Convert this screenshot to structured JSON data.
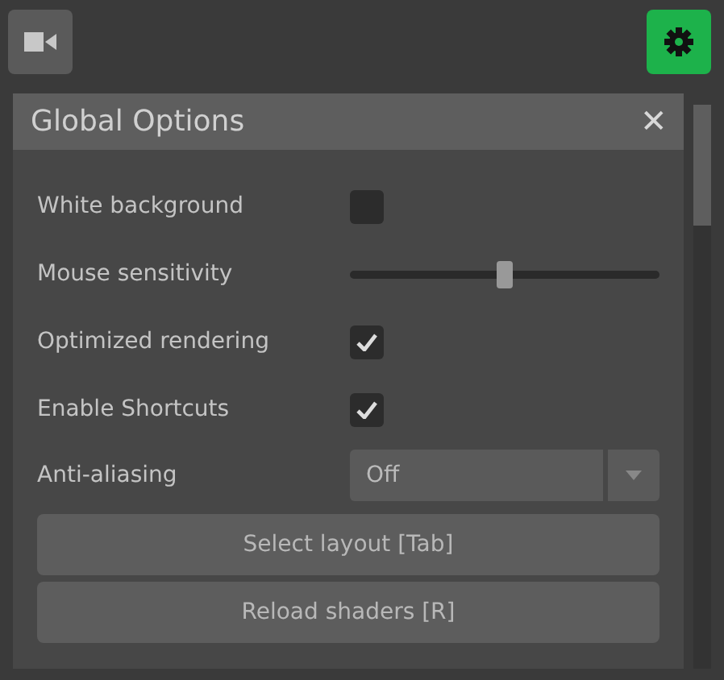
{
  "toolbar": {
    "camera_button": {
      "selected": false
    },
    "settings_button": {
      "selected": true
    }
  },
  "panel": {
    "title": "Global Options",
    "close": "✕",
    "rows": [
      {
        "kind": "checkbox",
        "label": "White background",
        "checked": false
      },
      {
        "kind": "slider",
        "label": "Mouse sensitivity",
        "level": 0.5
      },
      {
        "kind": "checkbox",
        "label": "Optimized rendering",
        "checked": true
      },
      {
        "kind": "checkbox",
        "label": "Enable Shortcuts",
        "checked": true
      },
      {
        "kind": "dropdown",
        "label": "Anti-aliasing",
        "value": "Off"
      }
    ],
    "buttons": [
      "Select layout [Tab]",
      "Reload shaders [R]"
    ]
  }
}
